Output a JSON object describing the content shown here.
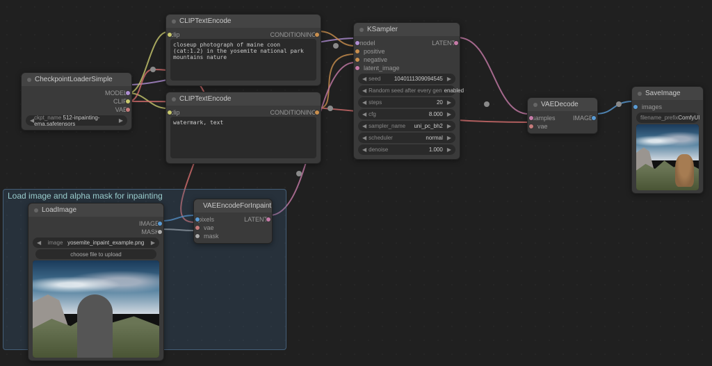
{
  "group": {
    "title": "Load image and alpha mask for inpainting"
  },
  "checkpoint": {
    "title": "CheckpointLoaderSimple",
    "outputs": [
      "MODEL",
      "CLIP",
      "VAE"
    ],
    "ckpt_label": "ckpt_name",
    "ckpt_value": "512-inpainting-ema.safetensors"
  },
  "clip1": {
    "title": "CLIPTextEncode",
    "input": "clip",
    "output": "CONDITIONING",
    "text": "closeup photograph of maine coon (cat:1.2) in the yosemite national park mountains nature"
  },
  "clip2": {
    "title": "CLIPTextEncode",
    "input": "clip",
    "output": "CONDITIONING",
    "text": "watermark, text"
  },
  "loadimage": {
    "title": "LoadImage",
    "outputs": [
      "IMAGE",
      "MASK"
    ],
    "image_label": "image",
    "image_value": "yosemite_inpaint_example.png",
    "upload": "choose file to upload"
  },
  "vaeencode": {
    "title": "VAEEncodeForInpaint",
    "inputs": [
      "pixels",
      "vae",
      "mask"
    ],
    "output": "LATENT"
  },
  "ksampler": {
    "title": "KSampler",
    "inputs": [
      "model",
      "positive",
      "negative",
      "latent_image"
    ],
    "output": "LATENT",
    "widgets": [
      {
        "label": "seed",
        "value": "1040111309094545"
      },
      {
        "label": "Random seed after every gen",
        "value": "enabled",
        "toggle": true
      },
      {
        "label": "steps",
        "value": "20"
      },
      {
        "label": "cfg",
        "value": "8.000"
      },
      {
        "label": "sampler_name",
        "value": "uni_pc_bh2"
      },
      {
        "label": "scheduler",
        "value": "normal"
      },
      {
        "label": "denoise",
        "value": "1.000"
      }
    ]
  },
  "vaedecode": {
    "title": "VAEDecode",
    "inputs": [
      "samples",
      "vae"
    ],
    "output": "IMAGE"
  },
  "saveimage": {
    "title": "SaveImage",
    "input": "images",
    "prefix_label": "filename_prefix",
    "prefix_value": "ComfyUI"
  }
}
